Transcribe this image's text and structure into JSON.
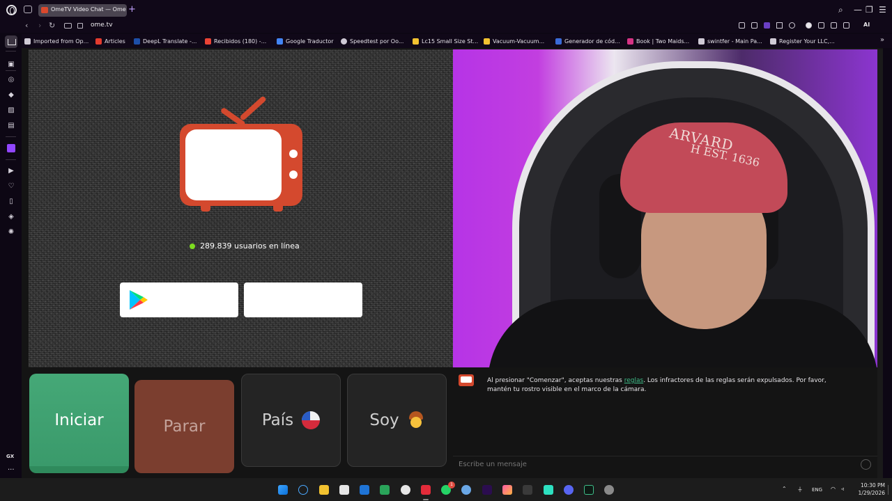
{
  "browser": {
    "tab_title": "OmeTV Video Chat — Ome",
    "new_tab": "+",
    "url": "ome.tv",
    "ai_label": "AI",
    "window_controls": {
      "search": "⌕",
      "minimize": "—",
      "restore": "❐",
      "more": "☰"
    }
  },
  "bookmarks": [
    {
      "label": "Imported from Op...",
      "icon": "folder-icon",
      "color": "#cfcad5"
    },
    {
      "label": "Articles",
      "icon": "articles-icon",
      "color": "#e33b2e"
    },
    {
      "label": "DeepL Translate -...",
      "icon": "deepl-icon",
      "color": "#1d4fa8"
    },
    {
      "label": "Recibidos (180) -...",
      "icon": "gmail-icon",
      "color": "#ea4335"
    },
    {
      "label": "Google Traductor",
      "icon": "translate-icon",
      "color": "#4285f4"
    },
    {
      "label": "Speedtest por Oo...",
      "icon": "speedtest-icon",
      "color": "#cfcad5"
    },
    {
      "label": "Lc15 Small Size St...",
      "icon": "lc-icon",
      "color": "#f2c230"
    },
    {
      "label": "Vacuum-Vacuum...",
      "icon": "vacuum-icon",
      "color": "#f2c230"
    },
    {
      "label": "Generador de cód...",
      "icon": "generator-icon",
      "color": "#3a6bd8"
    },
    {
      "label": "Book | Two Maids...",
      "icon": "maids-icon",
      "color": "#d63384"
    },
    {
      "label": "swintfer - Main Pa...",
      "icon": "swintfer-icon",
      "color": "#cfcad5"
    },
    {
      "label": "Register Your LLC,...",
      "icon": "llc-icon",
      "color": "#cfcad5"
    }
  ],
  "sidebar": {
    "footer_label": "GX",
    "more": "···"
  },
  "main": {
    "online_text": "289.839 usuarios en línea",
    "buttons": {
      "start": "Iniciar",
      "stop": "Parar",
      "country": "País",
      "gender": "Soy"
    },
    "chat": {
      "notice_prefix": "Al presionar \"Comenzar\", aceptas nuestras ",
      "notice_link": "reglas",
      "notice_suffix": ". Los infractores de las reglas serán expulsados. Por favor, mantén tu rostro visible en el marco de la cámara.",
      "input_placeholder": "Escribe un mensaje"
    },
    "cap_text": "ARVARD",
    "cap_text_2": "H  EST. 1636"
  },
  "taskbar": {
    "lang": "ENG",
    "time": "10:30 PM",
    "date": "1/29/2026",
    "whatsapp_badge": "1"
  },
  "colors": {
    "accent": "#c2a2ff",
    "tv_red": "#d4492e",
    "start_green": "#45a877",
    "stop_brown": "#7b3e2f",
    "online_green": "#7ddc1f"
  }
}
